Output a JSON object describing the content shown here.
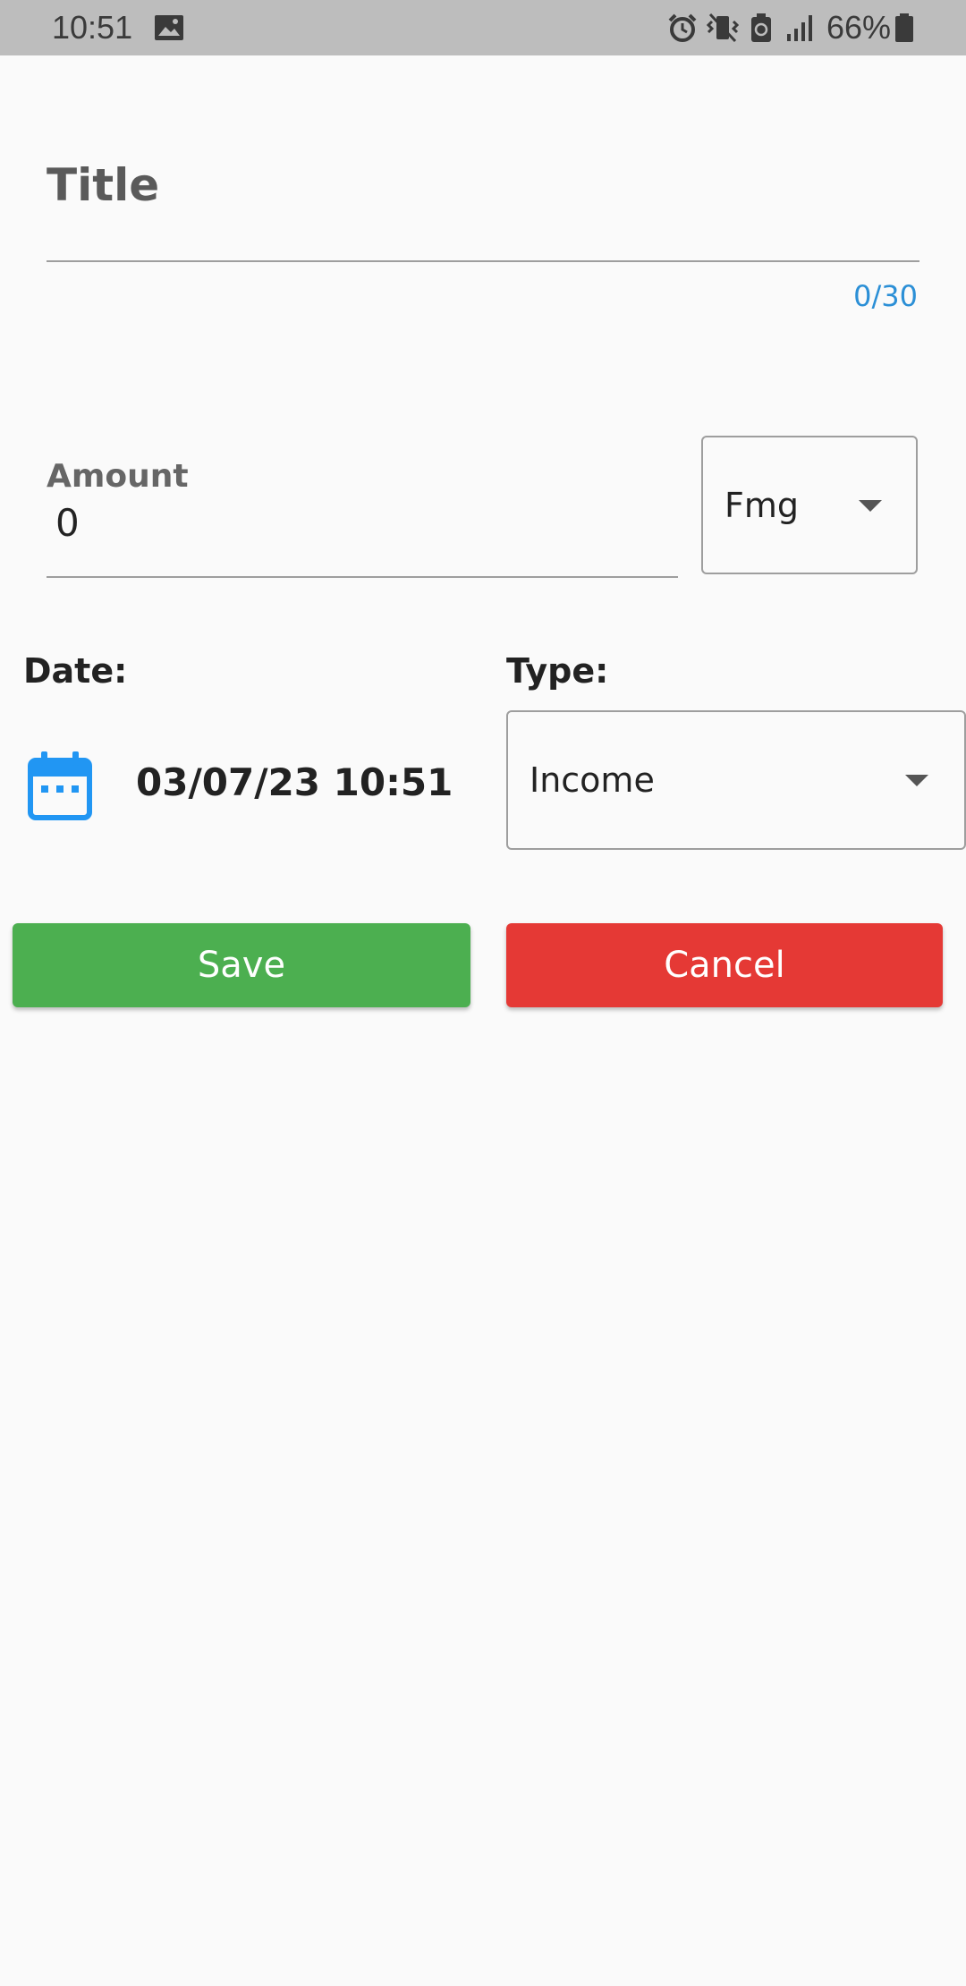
{
  "status_bar": {
    "time": "10:51",
    "battery": "66%",
    "icons": [
      "image-icon",
      "alarm-icon",
      "vibrate-icon",
      "battery-saver-icon",
      "signal-icon",
      "battery-icon"
    ]
  },
  "form": {
    "title": {
      "label": "Title",
      "counter": "0/30"
    },
    "amount": {
      "label": "Amount",
      "value": "0"
    },
    "currency": {
      "selected": "Fmg"
    },
    "date": {
      "label": "Date:",
      "value": "03/07/23 10:51"
    },
    "type": {
      "label": "Type:",
      "selected": "Income"
    },
    "buttons": {
      "save": "Save",
      "cancel": "Cancel"
    }
  },
  "colors": {
    "save": "#4caf50",
    "cancel": "#e53935",
    "accent": "#2b8fd6",
    "status_bar": "#bdbdbd",
    "background": "#fafafa"
  }
}
